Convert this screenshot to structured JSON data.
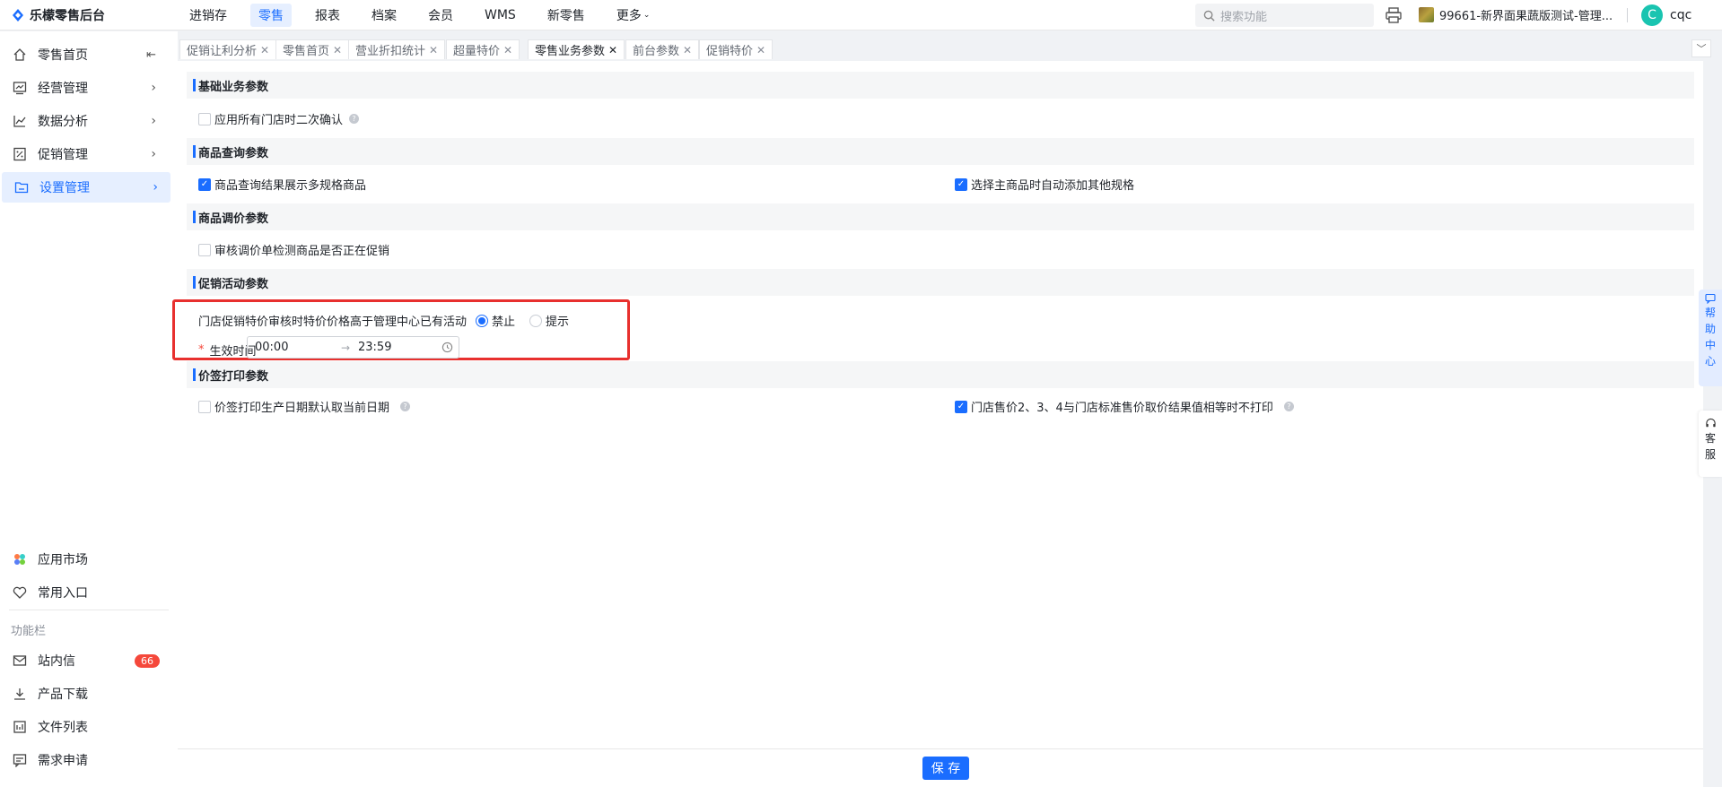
{
  "brand": {
    "name": "乐檬零售后台"
  },
  "topnav": {
    "items": [
      {
        "label": "进销存",
        "active": false
      },
      {
        "label": "零售",
        "active": true
      },
      {
        "label": "报表",
        "active": false
      },
      {
        "label": "档案",
        "active": false
      },
      {
        "label": "会员",
        "active": false
      },
      {
        "label": "WMS",
        "active": false
      },
      {
        "label": "新零售",
        "active": false
      },
      {
        "label": "更多",
        "active": false
      }
    ],
    "more_caret": "⌄"
  },
  "search": {
    "placeholder": "搜索功能"
  },
  "store": {
    "name": "99661-新界面果蔬版测试-管理..."
  },
  "user": {
    "initial": "C",
    "name": "cqc"
  },
  "sidebar": {
    "items": [
      {
        "label": "零售首页",
        "icon": "home-icon"
      },
      {
        "label": "经营管理",
        "icon": "chart-board-icon"
      },
      {
        "label": "数据分析",
        "icon": "line-chart-icon"
      },
      {
        "label": "促销管理",
        "icon": "promo-icon"
      },
      {
        "label": "设置管理",
        "icon": "settings-folder-icon",
        "active": true
      }
    ],
    "bottom": [
      {
        "label": "应用市场",
        "icon": "app-market-icon"
      },
      {
        "label": "常用入口",
        "icon": "heart-icon"
      }
    ],
    "section_label": "功能栏",
    "tools": [
      {
        "label": "站内信",
        "icon": "mail-icon",
        "badge": "66"
      },
      {
        "label": "产品下载",
        "icon": "download-icon"
      },
      {
        "label": "文件列表",
        "icon": "file-list-icon"
      },
      {
        "label": "需求申请",
        "icon": "request-icon"
      }
    ]
  },
  "tabs": [
    {
      "label": "促销让利分析",
      "active": false
    },
    {
      "label": "零售首页",
      "active": false
    },
    {
      "label": "营业折扣统计",
      "active": false
    },
    {
      "label": "超量特价",
      "active": false
    },
    {
      "label": "零售业务参数",
      "active": true
    },
    {
      "label": "前台参数",
      "active": false
    },
    {
      "label": "促销特价",
      "active": false
    }
  ],
  "sections": {
    "basic": {
      "title": "基础业务参数",
      "option1": {
        "label": "应用所有门店时二次确认",
        "checked": false
      }
    },
    "query": {
      "title": "商品查询参数",
      "option1": {
        "label": "商品查询结果展示多规格商品",
        "checked": true
      },
      "option2": {
        "label": "选择主商品时自动添加其他规格",
        "checked": true
      }
    },
    "price_adjust": {
      "title": "商品调价参数",
      "option1": {
        "label": "审核调价单检测商品是否正在促销",
        "checked": false
      }
    },
    "promo": {
      "title": "促销活动参数",
      "rule_label": "门店促销特价审核时特价价格高于管理中心已有活动",
      "radio_forbid": "禁止",
      "radio_tip": "提示",
      "selected": "禁止",
      "effective_label": "生效时间",
      "required_mark": "*",
      "time_start": "00:00",
      "time_arrow": "→",
      "time_end": "23:59"
    },
    "label_print": {
      "title": "价签打印参数",
      "option1": {
        "label": "价签打印生产日期默认取当前日期",
        "checked": false
      },
      "option2": {
        "label": "门店售价2、3、4与门店标准售价取价结果值相等时不打印",
        "checked": true
      }
    }
  },
  "footer": {
    "save_label": "保 存"
  },
  "float": {
    "help_center": [
      "帮",
      "助",
      "中",
      "心"
    ],
    "support": [
      "客",
      "服"
    ]
  },
  "colors": {
    "accent": "#1a6dff",
    "highlight": "#e8302e",
    "badge": "#f5483b"
  }
}
